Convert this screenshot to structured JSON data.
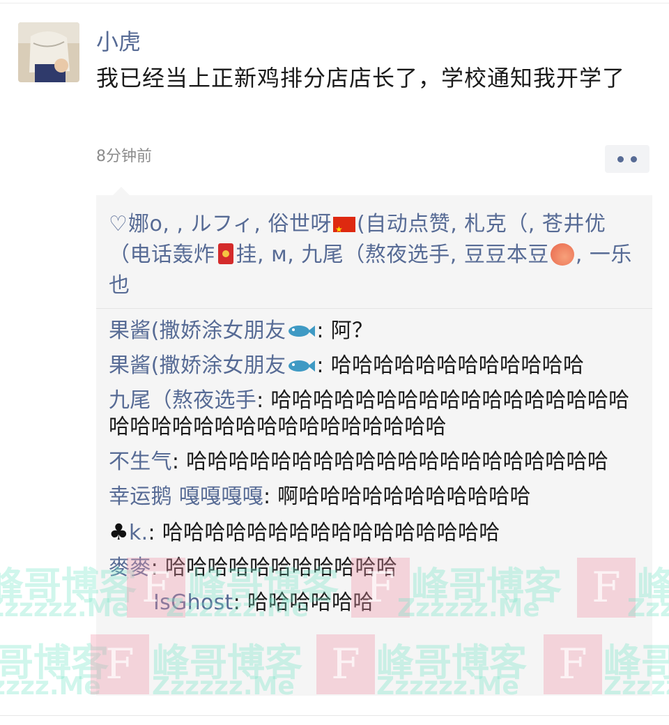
{
  "post": {
    "author": "小虎",
    "text": "我已经当上正新鸡排分店店长了，学校通知我开学了",
    "timestamp": "8分钟前"
  },
  "likes": {
    "heart_icon": "♡",
    "text_1": "娜",
    "text_2": "o, , ルフィ, 俗世呀",
    "text_3": "(自动点赞, 札克（, 苍井优（电话轰炸",
    "text_4": "挂, м, 九尾（熬夜选手, 豆豆本豆",
    "text_5": ", 一乐也"
  },
  "comments": [
    {
      "name": "果酱(撒娇涂女朋友",
      "emoji": "fish",
      "text": ": 阿？"
    },
    {
      "name": "果酱(撒娇涂女朋友",
      "emoji": "fish",
      "text": ": 哈哈哈哈哈哈哈哈哈哈哈哈"
    },
    {
      "name": "九尾（熬夜选手",
      "text": ": 哈哈哈哈哈哈哈哈哈哈哈哈哈哈哈哈哈哈哈哈哈哈哈哈哈哈哈哈哈哈哈哈哈"
    },
    {
      "name": "不生气",
      "text": ": 哈哈哈哈哈哈哈哈哈哈哈哈哈哈哈哈哈哈哈哈"
    },
    {
      "name": "幸运鹅 嘎嘎嘎嘎",
      "text": ": 啊哈哈哈哈哈哈哈哈哈哈哈"
    },
    {
      "name_icon": "♣",
      "name": "k.",
      "text": ": 哈哈哈哈哈哈哈哈哈哈哈哈哈哈哈哈"
    },
    {
      "name": "麥麥",
      "text": ": 哈哈哈哈哈哈哈哈哈哈哈"
    },
    {
      "name": "IsGhost",
      "text": ": 哈哈哈哈哈哈"
    }
  ],
  "watermark": {
    "text": "峰哥博客",
    "url": "Zzzzzz.Me",
    "letter": "F"
  },
  "colors": {
    "link_blue": "#576b95",
    "panel_bg": "#f5f5f5",
    "timestamp_gray": "#8c8c8c"
  }
}
